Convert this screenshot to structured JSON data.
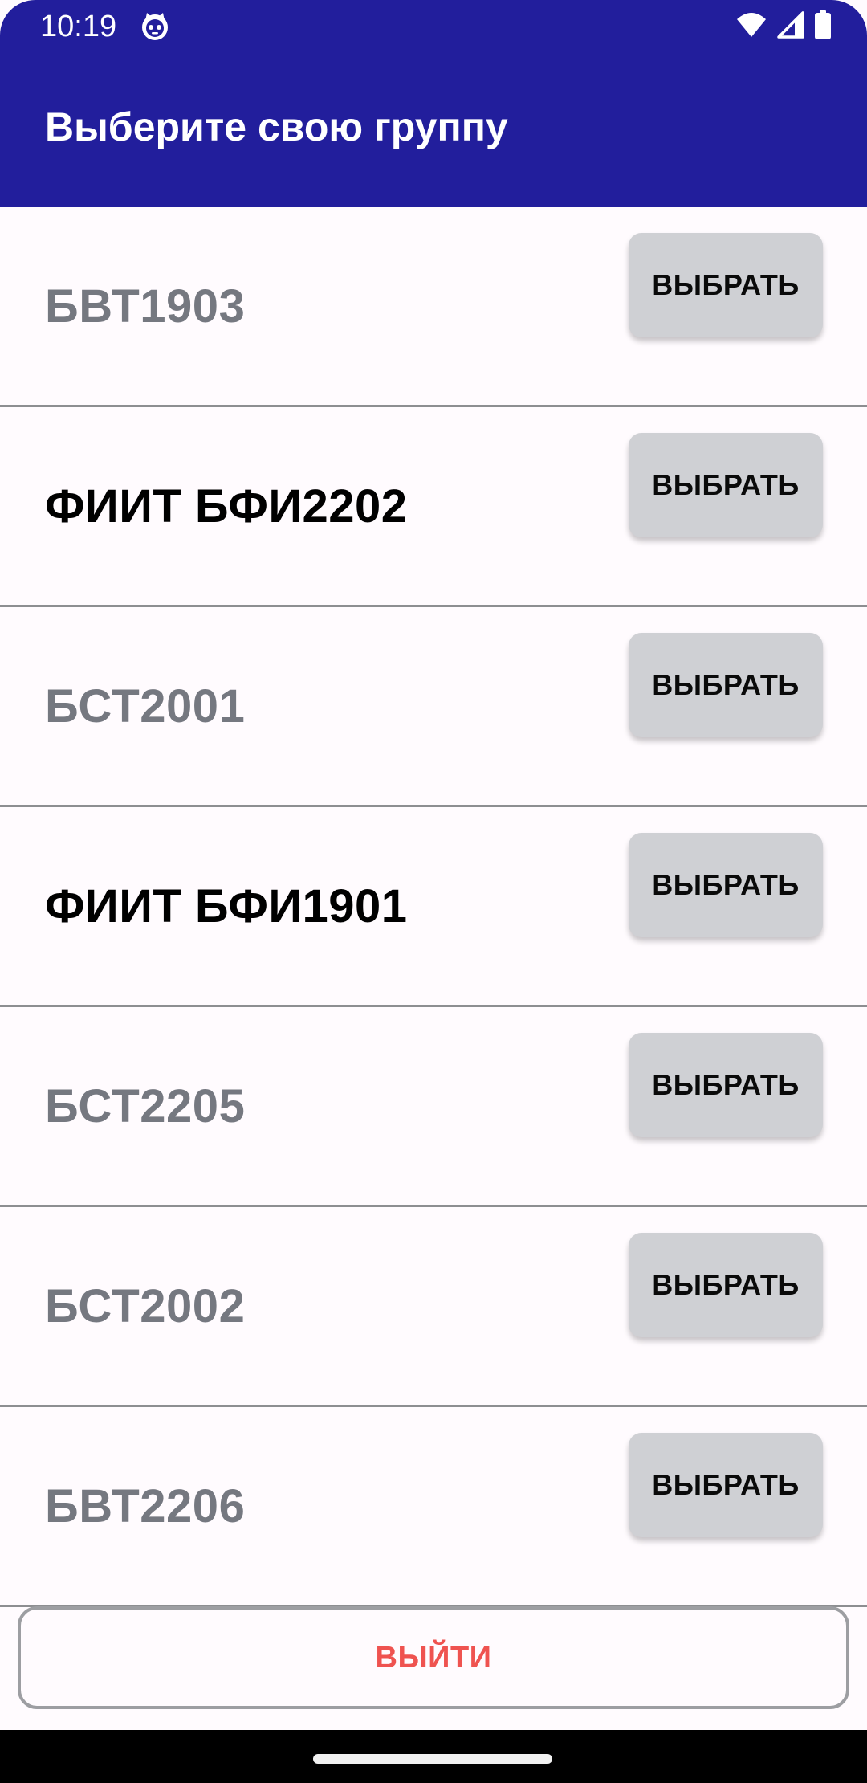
{
  "status_bar": {
    "time": "10:19",
    "app_icon": "cat-face-icon",
    "icons": [
      "wifi-icon",
      "cellular-signal-icon",
      "battery-icon"
    ]
  },
  "app_bar": {
    "title": "Выберите свою группу",
    "background_color": "#221e9c"
  },
  "groups": [
    {
      "name": "БВТ1903",
      "style": "muted",
      "button_label": "ВЫБРАТЬ"
    },
    {
      "name": "ФИИТ БФИ2202",
      "style": "strong",
      "button_label": "ВЫБРАТЬ"
    },
    {
      "name": "БСТ2001",
      "style": "muted",
      "button_label": "ВЫБРАТЬ"
    },
    {
      "name": "ФИИТ БФИ1901",
      "style": "strong",
      "button_label": "ВЫБРАТЬ"
    },
    {
      "name": "БСТ2205",
      "style": "muted",
      "button_label": "ВЫБРАТЬ"
    },
    {
      "name": "БСТ2002",
      "style": "muted",
      "button_label": "ВЫБРАТЬ"
    },
    {
      "name": "БВТ2206",
      "style": "muted",
      "button_label": "ВЫБРАТЬ"
    }
  ],
  "logout_button": {
    "label": "ВЫЙТИ",
    "text_color": "#ef5350"
  },
  "colors": {
    "muted_text": "#757880",
    "strong_text": "#000000",
    "button_bg": "#cfd0d4",
    "divider": "#8d8e91"
  }
}
